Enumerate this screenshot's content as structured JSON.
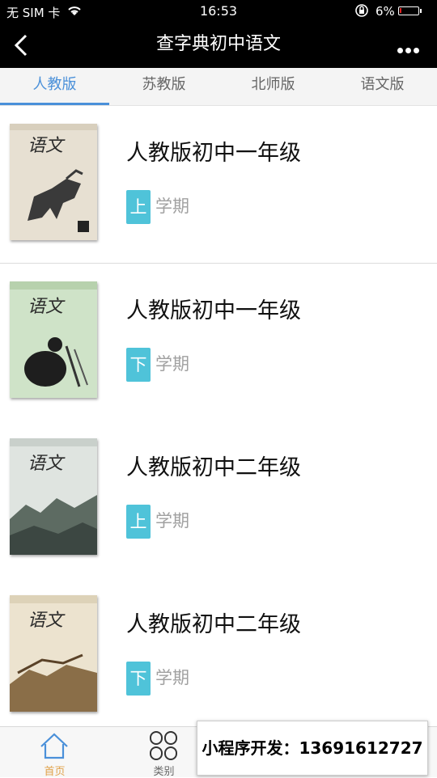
{
  "status": {
    "carrier": "无 SIM 卡",
    "time": "16:53",
    "battery": "6%"
  },
  "header": {
    "title": "查字典初中语文"
  },
  "tabs": [
    {
      "label": "人教版",
      "active": true
    },
    {
      "label": "苏教版",
      "active": false
    },
    {
      "label": "北师版",
      "active": false
    },
    {
      "label": "语文版",
      "active": false
    }
  ],
  "books": [
    {
      "title": "人教版初中一年级",
      "term_badge": "上",
      "term_label": "学期",
      "cover_text": "语文"
    },
    {
      "title": "人教版初中一年级",
      "term_badge": "下",
      "term_label": "学期",
      "cover_text": "语文"
    },
    {
      "title": "人教版初中二年级",
      "term_badge": "上",
      "term_label": "学期",
      "cover_text": "语文"
    },
    {
      "title": "人教版初中二年级",
      "term_badge": "下",
      "term_label": "学期",
      "cover_text": "语文"
    }
  ],
  "bottom_tabs": [
    {
      "label": "首页",
      "icon": "home-icon",
      "active": true
    },
    {
      "label": "类别",
      "icon": "category-icon",
      "active": false
    }
  ],
  "watermark": "小程序开发：13691612727",
  "colors": {
    "accent": "#4a90d9",
    "badge": "#4fc3d9",
    "home_active": "#e0a24a"
  }
}
